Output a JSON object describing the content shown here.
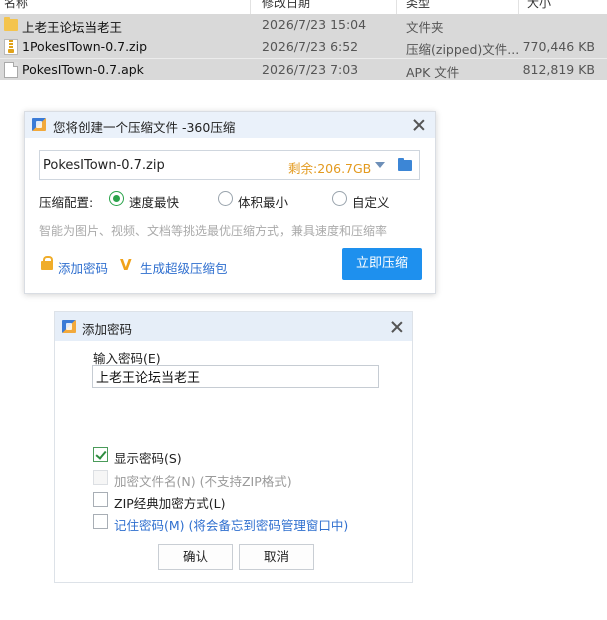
{
  "file_list": {
    "columns": [
      "名称",
      "修改日期",
      "类型",
      "大小"
    ],
    "rows": [
      {
        "icon": "folder-icon",
        "name": "上老王论坛当老王",
        "date": "2026/7/23 15:04",
        "type": "文件夹",
        "size": ""
      },
      {
        "icon": "zip-icon",
        "name": "1PokesITown-0.7.zip",
        "date": "2026/7/23 6:52",
        "type": "压缩(zipped)文件...",
        "size": "770,446 KB"
      },
      {
        "icon": "document-icon",
        "name": "PokesITown-0.7.apk",
        "date": "2026/7/23 7:03",
        "type": "APK 文件",
        "size": "812,819 KB"
      }
    ]
  },
  "compress_dialog": {
    "title": "您将创建一个压缩文件 -360压缩",
    "filename": "PokesITown-0.7.zip",
    "free_space": "剩余:206.7GB",
    "config_label": "压缩配置:",
    "options": [
      {
        "label": "速度最快",
        "selected": true
      },
      {
        "label": "体积最小",
        "selected": false
      },
      {
        "label": "自定义",
        "selected": false
      }
    ],
    "hint": "智能为图片、视频、文档等挑选最优压缩方式，兼具速度和压缩率",
    "add_password_link": "添加密码",
    "super_package_link": "生成超级压缩包",
    "compress_button": "立即压缩",
    "accent_color": "#1e90ee",
    "free_color": "#e39a1f"
  },
  "password_dialog": {
    "title": "添加密码",
    "input_label": "输入密码(E)",
    "password_value": "上老王论坛当老王",
    "checkboxes": [
      {
        "label": "显示密码(S)",
        "note": "",
        "checked": true,
        "disabled": false
      },
      {
        "label": "加密文件名(N)",
        "note": "(不支持ZIP格式)",
        "checked": false,
        "disabled": true
      },
      {
        "label": "ZIP经典加密方式(L)",
        "note": "",
        "checked": false,
        "disabled": false
      },
      {
        "label": "记住密码(M)",
        "note": "(将会备忘到密码管理窗口中)",
        "checked": false,
        "disabled": false
      }
    ],
    "ok_button": "确认",
    "cancel_button": "取消"
  }
}
